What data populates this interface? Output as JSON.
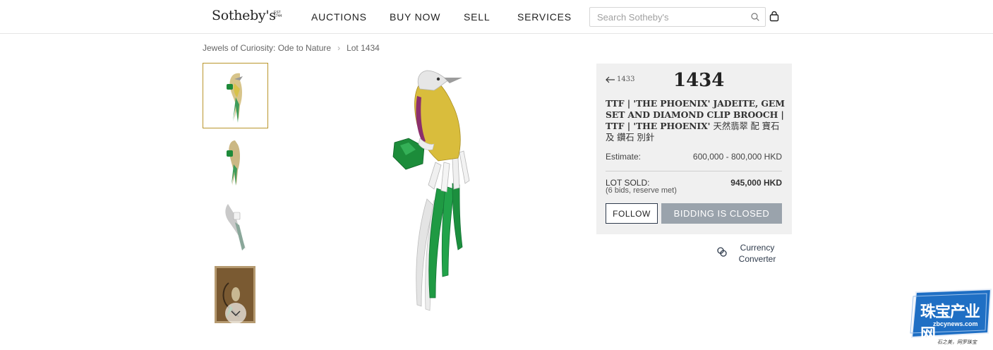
{
  "header": {
    "logo": "Sotheby's",
    "logo_est": "EST 1744",
    "nav": [
      "AUCTIONS",
      "BUY NOW",
      "SELL",
      "SERVICES"
    ],
    "search_placeholder": "Search Sotheby's"
  },
  "breadcrumb": {
    "sale": "Jewels of Curiosity: Ode to Nature",
    "lot": "Lot 1434"
  },
  "thumbnails": {
    "count": 4,
    "active_index": 0
  },
  "lot": {
    "prev_label": "1433",
    "number": "1434",
    "title_latin": "TTF | 'THE PHOENIX' JADEITE, GEM SET AND DIAMOND CLIP BROOCH | TTF | 'THE PHOENIX'",
    "title_cjk": "天然翡翠 配 寶石 及 鑽石 別針",
    "estimate_label": "Estimate:",
    "estimate_value": "600,000 - 800,000 HKD",
    "sold_label": "LOT SOLD:",
    "sold_value": "945,000 HKD",
    "sold_detail": "(6 bids, reserve met)",
    "follow_label": "FOLLOW",
    "bidding_label": "BIDDING IS CLOSED"
  },
  "currency_converter": {
    "line1": "Currency",
    "line2": "Converter"
  },
  "watermark": {
    "brand": "珠宝产业网",
    "url": "zbcynews.com",
    "slogan": "石之美，网罗珠宝"
  },
  "colors": {
    "accent_gold": "#b9952b",
    "panel_bg": "#f0f0f0",
    "button_disabled": "#9aa3ac",
    "navy": "#2f3b4c",
    "watermark_blue": "#1f6fc4"
  }
}
